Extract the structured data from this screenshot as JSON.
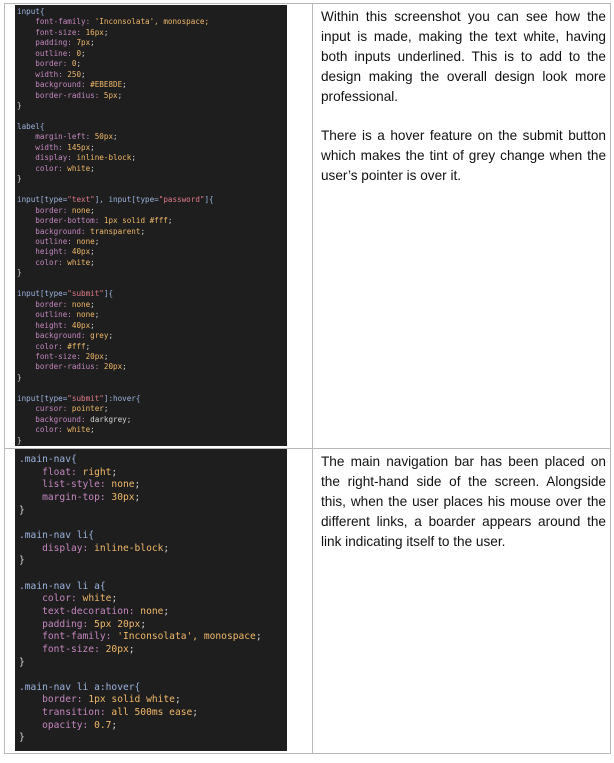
{
  "rows": [
    {
      "code_lines": [
        [
          [
            "input{",
            "sel"
          ]
        ],
        [
          [
            "    font-family: ",
            "prop"
          ],
          [
            "'Inconsolata'",
            "val"
          ],
          [
            ", monospace;",
            "val"
          ]
        ],
        [
          [
            "    font-size: ",
            "prop"
          ],
          [
            "16px",
            "val"
          ],
          [
            ";",
            "punc"
          ]
        ],
        [
          [
            "    padding: ",
            "prop"
          ],
          [
            "7px",
            "val"
          ],
          [
            ";",
            "punc"
          ]
        ],
        [
          [
            "    outline: ",
            "prop"
          ],
          [
            "0",
            "val"
          ],
          [
            ";",
            "punc"
          ]
        ],
        [
          [
            "    border: ",
            "prop"
          ],
          [
            "0",
            "val"
          ],
          [
            ";",
            "punc"
          ]
        ],
        [
          [
            "    width: ",
            "prop"
          ],
          [
            "250",
            "val"
          ],
          [
            ";",
            "punc"
          ]
        ],
        [
          [
            "    background: ",
            "prop"
          ],
          [
            "#EBE8DE",
            "val"
          ],
          [
            ";",
            "punc"
          ]
        ],
        [
          [
            "    border-radius: ",
            "prop"
          ],
          [
            "5px",
            "val"
          ],
          [
            ";",
            "punc"
          ]
        ],
        [
          [
            "}",
            "punc"
          ]
        ],
        [
          [
            "",
            "punc"
          ]
        ],
        [
          [
            "label{",
            "sel"
          ]
        ],
        [
          [
            "    margin-left: ",
            "prop"
          ],
          [
            "50px",
            "val"
          ],
          [
            ";",
            "punc"
          ]
        ],
        [
          [
            "    width: ",
            "prop"
          ],
          [
            "145px",
            "val"
          ],
          [
            ";",
            "punc"
          ]
        ],
        [
          [
            "    display: ",
            "prop"
          ],
          [
            "inline-block",
            "val"
          ],
          [
            ";",
            "punc"
          ]
        ],
        [
          [
            "    color: ",
            "prop"
          ],
          [
            "white",
            "val"
          ],
          [
            ";",
            "punc"
          ]
        ],
        [
          [
            "}",
            "punc"
          ]
        ],
        [
          [
            "",
            "punc"
          ]
        ],
        [
          [
            "input[type=",
            "sel"
          ],
          [
            "\"text\"",
            "str"
          ],
          [
            "], input[type=",
            "sel"
          ],
          [
            "\"password\"",
            "str"
          ],
          [
            "]{",
            "sel"
          ]
        ],
        [
          [
            "    border: ",
            "prop"
          ],
          [
            "none",
            "val"
          ],
          [
            ";",
            "punc"
          ]
        ],
        [
          [
            "    border-bottom: ",
            "prop"
          ],
          [
            "1px solid #fff",
            "val"
          ],
          [
            ";",
            "punc"
          ]
        ],
        [
          [
            "    background: ",
            "prop"
          ],
          [
            "transparent",
            "val"
          ],
          [
            ";",
            "punc"
          ]
        ],
        [
          [
            "    outline: ",
            "prop"
          ],
          [
            "none",
            "val"
          ],
          [
            ";",
            "punc"
          ]
        ],
        [
          [
            "    height: ",
            "prop"
          ],
          [
            "40px",
            "val"
          ],
          [
            ";",
            "punc"
          ]
        ],
        [
          [
            "    color: ",
            "prop"
          ],
          [
            "white",
            "val"
          ],
          [
            ";",
            "punc"
          ]
        ],
        [
          [
            "}",
            "punc"
          ]
        ],
        [
          [
            "",
            "punc"
          ]
        ],
        [
          [
            "input[type=",
            "sel"
          ],
          [
            "\"submit\"",
            "str"
          ],
          [
            "]{",
            "sel"
          ]
        ],
        [
          [
            "    border: ",
            "prop"
          ],
          [
            "none",
            "val"
          ],
          [
            ";",
            "punc"
          ]
        ],
        [
          [
            "    outline: ",
            "prop"
          ],
          [
            "none",
            "val"
          ],
          [
            ";",
            "punc"
          ]
        ],
        [
          [
            "    height: ",
            "prop"
          ],
          [
            "40px",
            "val"
          ],
          [
            ";",
            "punc"
          ]
        ],
        [
          [
            "    background: ",
            "prop"
          ],
          [
            "grey",
            "val"
          ],
          [
            ";",
            "punc"
          ]
        ],
        [
          [
            "    color: ",
            "prop"
          ],
          [
            "#fff",
            "val"
          ],
          [
            ";",
            "punc"
          ]
        ],
        [
          [
            "    font-size: ",
            "prop"
          ],
          [
            "20px",
            "val"
          ],
          [
            ";",
            "punc"
          ]
        ],
        [
          [
            "    border-radius: ",
            "prop"
          ],
          [
            "20px",
            "val"
          ],
          [
            ";",
            "punc"
          ]
        ],
        [
          [
            "}",
            "punc"
          ]
        ],
        [
          [
            "",
            "punc"
          ]
        ],
        [
          [
            "input[type=",
            "sel"
          ],
          [
            "\"submit\"",
            "str"
          ],
          [
            "]:hover{",
            "sel"
          ]
        ],
        [
          [
            "    cursor: ",
            "prop"
          ],
          [
            "pointer",
            "val"
          ],
          [
            ";",
            "punc"
          ]
        ],
        [
          [
            "    background: ",
            "prop"
          ],
          [
            "darkgrey",
            "punc"
          ],
          [
            ";",
            "punc"
          ]
        ],
        [
          [
            "    color: ",
            "prop"
          ],
          [
            "white",
            "val"
          ],
          [
            ";",
            "punc"
          ]
        ],
        [
          [
            "}",
            "punc"
          ]
        ]
      ],
      "paragraphs": [
        "Within this screenshot you can see how the input is made, making the text white, having both inputs underlined. This is to add to the design making the overall design look more professional.",
        "There is a hover feature on the submit button which makes the tint of grey change when the user’s pointer is over it."
      ]
    },
    {
      "code_lines": [
        [
          [
            ".main-nav{",
            "sel"
          ]
        ],
        [
          [
            "    float: ",
            "prop"
          ],
          [
            "right",
            "val"
          ],
          [
            ";",
            "punc"
          ]
        ],
        [
          [
            "    list-style: ",
            "prop"
          ],
          [
            "none",
            "val"
          ],
          [
            ";",
            "punc"
          ]
        ],
        [
          [
            "    margin-top: ",
            "prop"
          ],
          [
            "30px",
            "val"
          ],
          [
            ";",
            "punc"
          ]
        ],
        [
          [
            "}",
            "punc"
          ]
        ],
        [
          [
            "",
            "punc"
          ]
        ],
        [
          [
            ".main-nav li{",
            "sel"
          ]
        ],
        [
          [
            "    display: ",
            "prop"
          ],
          [
            "inline-block",
            "val"
          ],
          [
            ";",
            "punc"
          ]
        ],
        [
          [
            "}",
            "punc"
          ]
        ],
        [
          [
            "",
            "punc"
          ]
        ],
        [
          [
            ".main-nav li a{",
            "sel"
          ]
        ],
        [
          [
            "    color: ",
            "prop"
          ],
          [
            "white",
            "val"
          ],
          [
            ";",
            "punc"
          ]
        ],
        [
          [
            "    text-decoration: ",
            "prop"
          ],
          [
            "none",
            "val"
          ],
          [
            ";",
            "punc"
          ]
        ],
        [
          [
            "    padding: ",
            "prop"
          ],
          [
            "5px 20px",
            "val"
          ],
          [
            ";",
            "punc"
          ]
        ],
        [
          [
            "    font-family: ",
            "prop"
          ],
          [
            "'Inconsolata', monospace",
            "val"
          ],
          [
            ";",
            "punc"
          ]
        ],
        [
          [
            "    font-size: ",
            "prop"
          ],
          [
            "20px",
            "val"
          ],
          [
            ";",
            "punc"
          ]
        ],
        [
          [
            "}",
            "punc"
          ]
        ],
        [
          [
            "",
            "punc"
          ]
        ],
        [
          [
            ".main-nav li a:hover{",
            "sel"
          ]
        ],
        [
          [
            "    border: ",
            "prop"
          ],
          [
            "1px solid white",
            "val"
          ],
          [
            ";",
            "punc"
          ]
        ],
        [
          [
            "    transition: ",
            "prop"
          ],
          [
            "all 500ms ease",
            "val"
          ],
          [
            ";",
            "punc"
          ]
        ],
        [
          [
            "    opacity: ",
            "prop"
          ],
          [
            "0.7",
            "val"
          ],
          [
            ";",
            "punc"
          ]
        ],
        [
          [
            "}",
            "punc"
          ]
        ]
      ],
      "paragraphs": [
        "The main navigation bar has been placed on the right-hand side of the screen. Alongside this, when the user places his mouse over the different links, a boarder appears around the link indicating itself to the user."
      ]
    }
  ]
}
